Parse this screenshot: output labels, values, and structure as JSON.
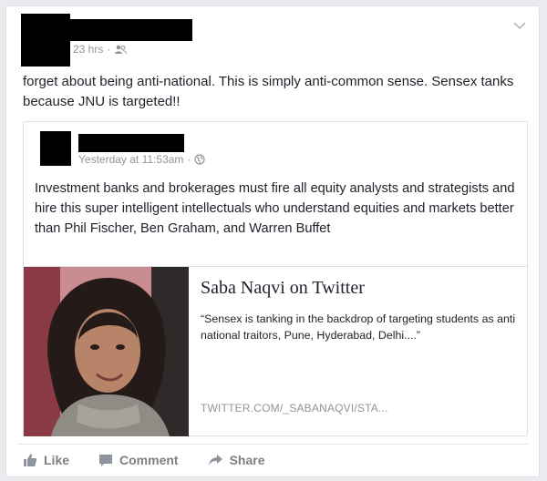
{
  "post": {
    "timestamp": "23 hrs",
    "text": "forget about being anti-national. This is simply anti-common sense. Sensex tanks because JNU is targeted!!",
    "audience_icon": "friends-icon",
    "menu_icon": "chevron-down-icon"
  },
  "shared_post": {
    "timestamp": "Yesterday at 11:53am",
    "audience_icon": "globe-icon",
    "text": "Investment banks and brokerages must fire all equity analysts and strategists and hire this super intelligent intellectuals who understand equities and markets better than Phil Fischer, Ben Graham, and Warren Buffet",
    "link": {
      "title": "Saba Naqvi on Twitter",
      "description": "“Sensex is tanking in the backdrop of targeting students as anti national traitors, Pune, Hyderabad, Delhi....”",
      "domain": "TWITTER.COM/_SABANAQVI/STA..."
    }
  },
  "actions": {
    "like": "Like",
    "comment": "Comment",
    "share": "Share"
  },
  "colors": {
    "meta_text": "#90949c",
    "action_text": "#7f7f7f",
    "border": "#dddfe2"
  }
}
